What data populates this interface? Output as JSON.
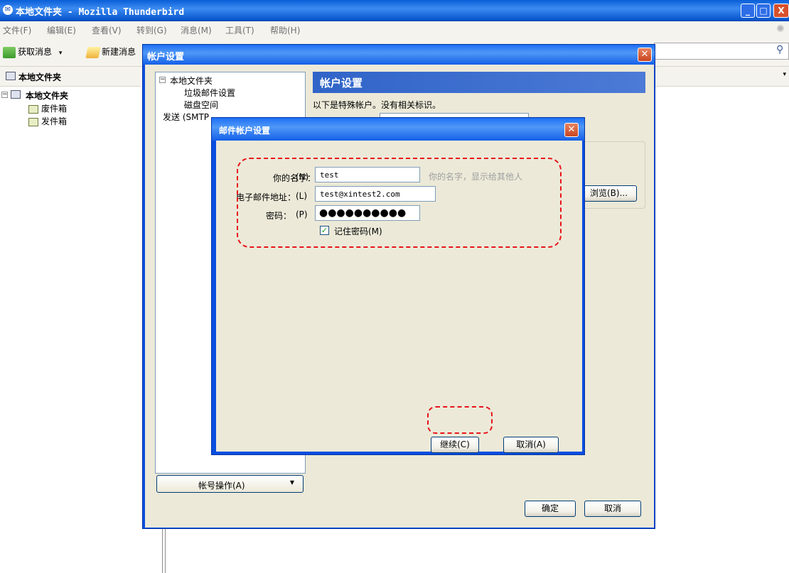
{
  "window": {
    "title": "本地文件夹 - Mozilla Thunderbird",
    "controls": {
      "minimize": "_",
      "maximize": "□",
      "close": "X"
    }
  },
  "menubar": {
    "items": [
      "文件(F)",
      "编辑(E)",
      "查看(V)",
      "转到(G)",
      "消息(M)",
      "工具(T)",
      "帮助(H)"
    ]
  },
  "toolbar": {
    "get_messages": "获取消息",
    "get_messages_arrow": "▾",
    "new_message": "新建消息"
  },
  "folder_pane": {
    "header": "本地文件夹",
    "root": "本地文件夹",
    "folders": [
      "废件箱",
      "发件箱"
    ]
  },
  "account_dialog": {
    "title": "帐户设置",
    "tree": [
      "本地文件夹",
      "垃圾邮件设置",
      "磁盘空间",
      "发送 (SMTP"
    ],
    "account_actions": "帐号操作(A)",
    "right_header": "帐户设置",
    "description": "以下是特殊帐户。没有相关标识。",
    "browse": "浏览(B)...",
    "ok": "确定",
    "cancel": "取消"
  },
  "mail_dialog": {
    "title": "邮件帐户设置",
    "name_label": "你的名字：",
    "name_key": "(N)",
    "name_value": "test",
    "name_hint": "你的名字，显示给其他人",
    "email_label": "电子邮件地址：",
    "email_key": "(L)",
    "email_value": "test@xintest2.com",
    "password_label": "密码：",
    "password_key": "(P)",
    "password_value": "●●●●●●●●●●",
    "remember_label": "记住密码(M)",
    "remember_checked": true,
    "continue": "继续(C)",
    "cancel": "取消(A)"
  },
  "colors": {
    "annotation": "#e8131b",
    "xp_blue": "#0a4ee0",
    "dialog_face": "#ece9d8"
  }
}
